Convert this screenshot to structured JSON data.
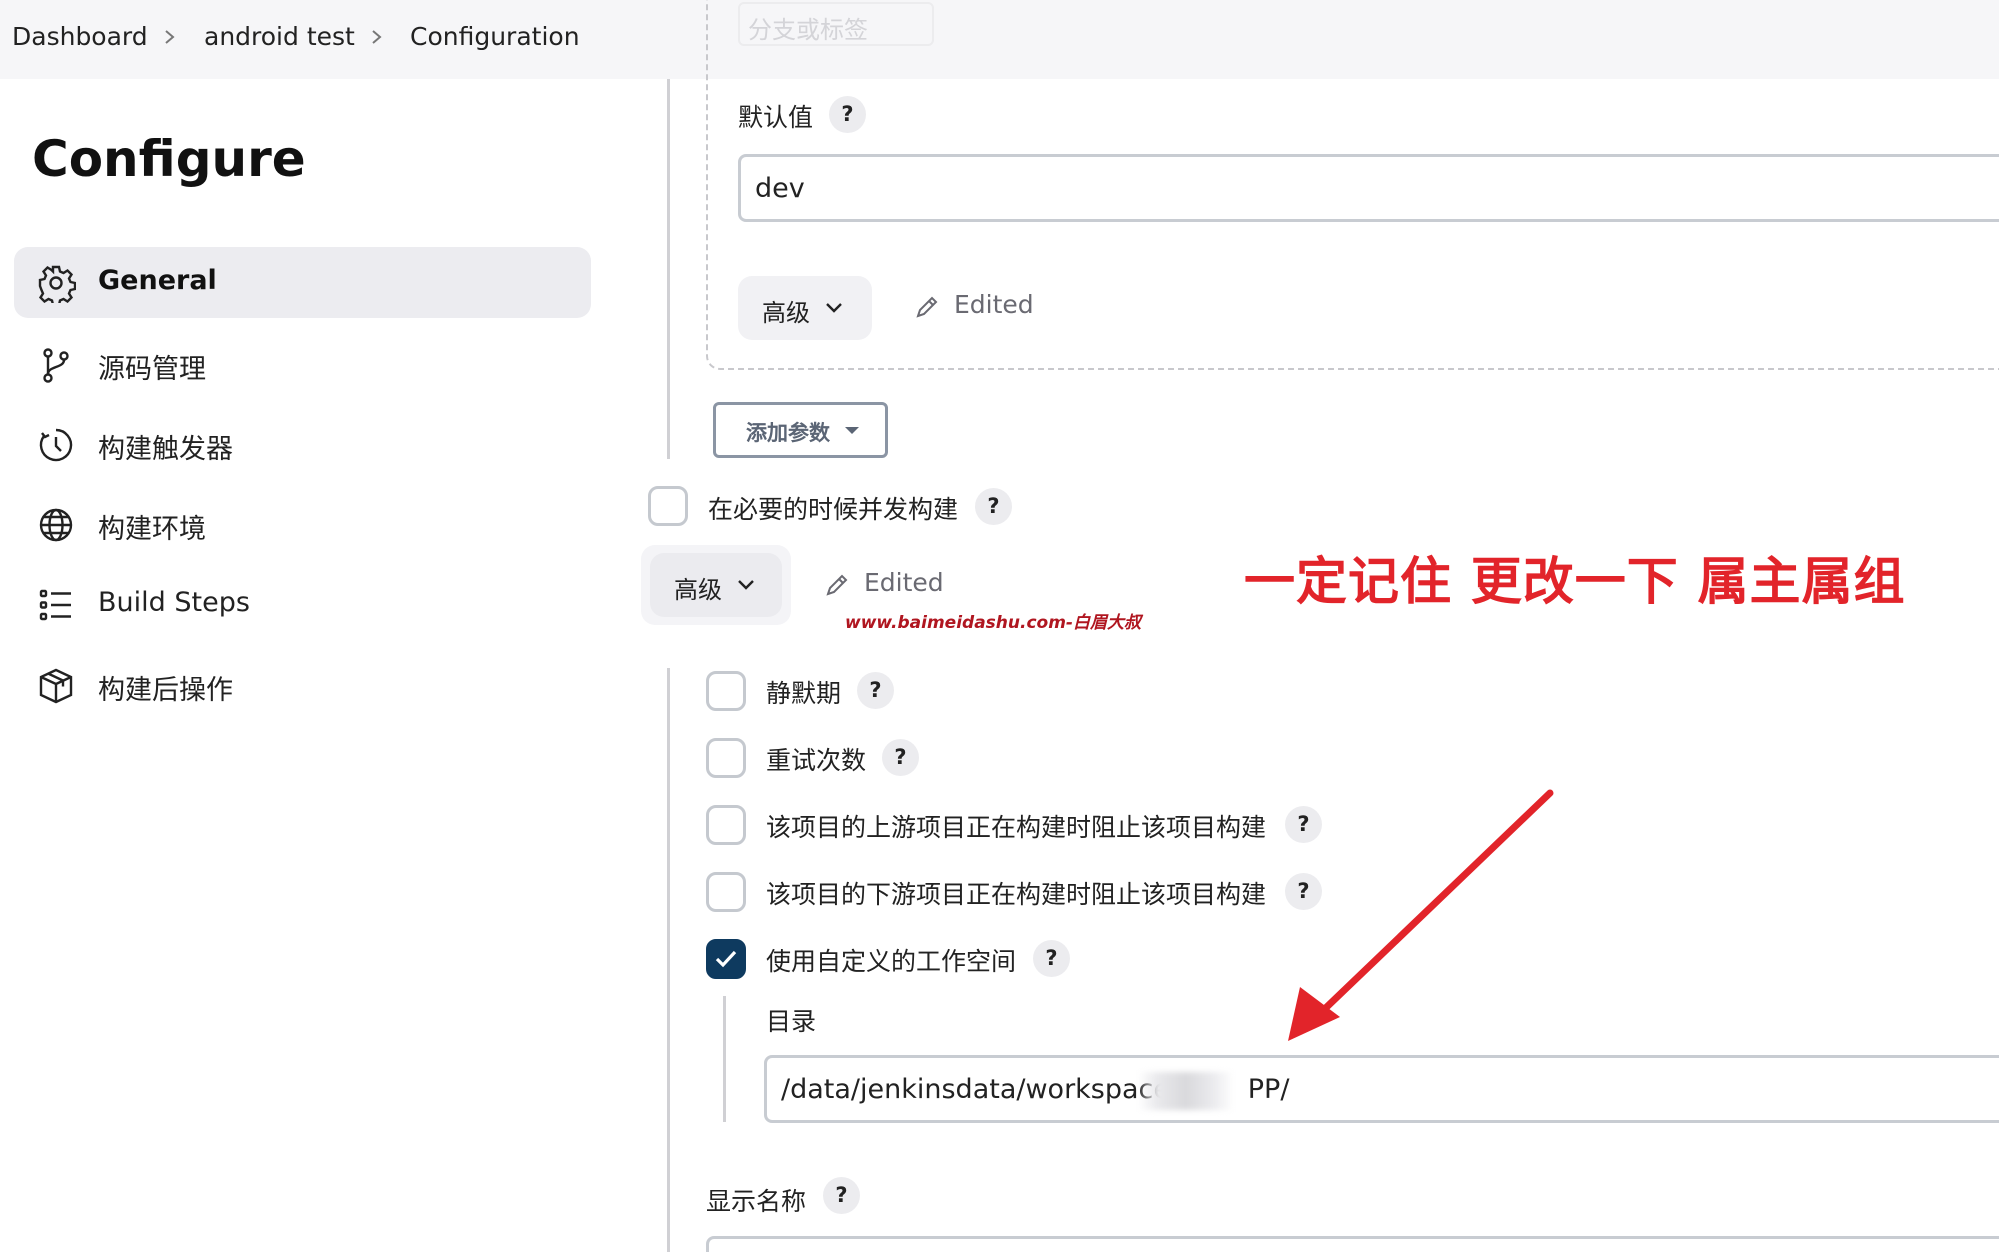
{
  "breadcrumb": {
    "items": [
      "Dashboard",
      "android test",
      "Configuration"
    ]
  },
  "sidebar": {
    "title": "Configure",
    "items": [
      {
        "label": "General",
        "icon": "gear-icon",
        "active": true
      },
      {
        "label": "源码管理",
        "icon": "branch-icon",
        "active": false
      },
      {
        "label": "构建触发器",
        "icon": "timer-icon",
        "active": false
      },
      {
        "label": "构建环境",
        "icon": "globe-icon",
        "active": false
      },
      {
        "label": "Build Steps",
        "icon": "list-icon",
        "active": false
      },
      {
        "label": "构建后操作",
        "icon": "box-icon",
        "active": false
      }
    ]
  },
  "param": {
    "faded_select": "分支或标签",
    "default_label": "默认值",
    "default_value": "dev",
    "advanced_label": "高级",
    "edited_label": "Edited"
  },
  "add_param": {
    "label": "添加参数"
  },
  "concurrent": {
    "label": "在必要的时候并发构建",
    "checked": false
  },
  "advanced": {
    "label": "高级",
    "edited_label": "Edited"
  },
  "options": [
    {
      "label": "静默期",
      "checked": false
    },
    {
      "label": "重试次数",
      "checked": false
    },
    {
      "label": "该项目的上游项目正在构建时阻止该项目构建",
      "checked": false
    },
    {
      "label": "该项目的下游项目正在构建时阻止该项目构建",
      "checked": false
    },
    {
      "label": "使用自定义的工作空间",
      "checked": true
    }
  ],
  "workspace": {
    "dir_label": "目录",
    "dir_value": "/data/jenkinsdata/workspace/        PP/"
  },
  "display_name": {
    "label": "显示名称"
  },
  "annotation": {
    "text": "一定记住 更改一下 属主属组",
    "color": "#e2242a"
  },
  "watermark": "www.baimeidashu.com-白眉大叔",
  "colors": {
    "checkbox_checked": "#0e3a5f",
    "annotation_red": "#e2242a"
  }
}
